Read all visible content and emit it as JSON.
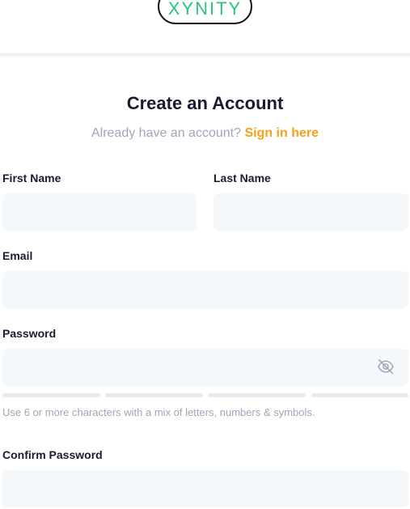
{
  "header": {
    "logo_text": "XYNITY"
  },
  "main": {
    "title": "Create an Account",
    "subtitle_prefix": "Already have an account?",
    "signin_link": "Sign in here"
  },
  "form": {
    "first_name": {
      "label": "First Name",
      "value": ""
    },
    "last_name": {
      "label": "Last Name",
      "value": ""
    },
    "email": {
      "label": "Email",
      "value": ""
    },
    "password": {
      "label": "Password",
      "value": "",
      "strength_filled": 0,
      "strength_segments": 4
    },
    "password_hint": "Use 6 or more characters with a mix of letters, numbers & symbols.",
    "confirm_password": {
      "label": "Confirm Password",
      "value": ""
    }
  },
  "icons": {
    "password_toggle": "eye-slash-icon"
  },
  "colors": {
    "accent": "#f6a21b",
    "brand": "#2bc47e",
    "input_bg": "#f5f8fa"
  }
}
